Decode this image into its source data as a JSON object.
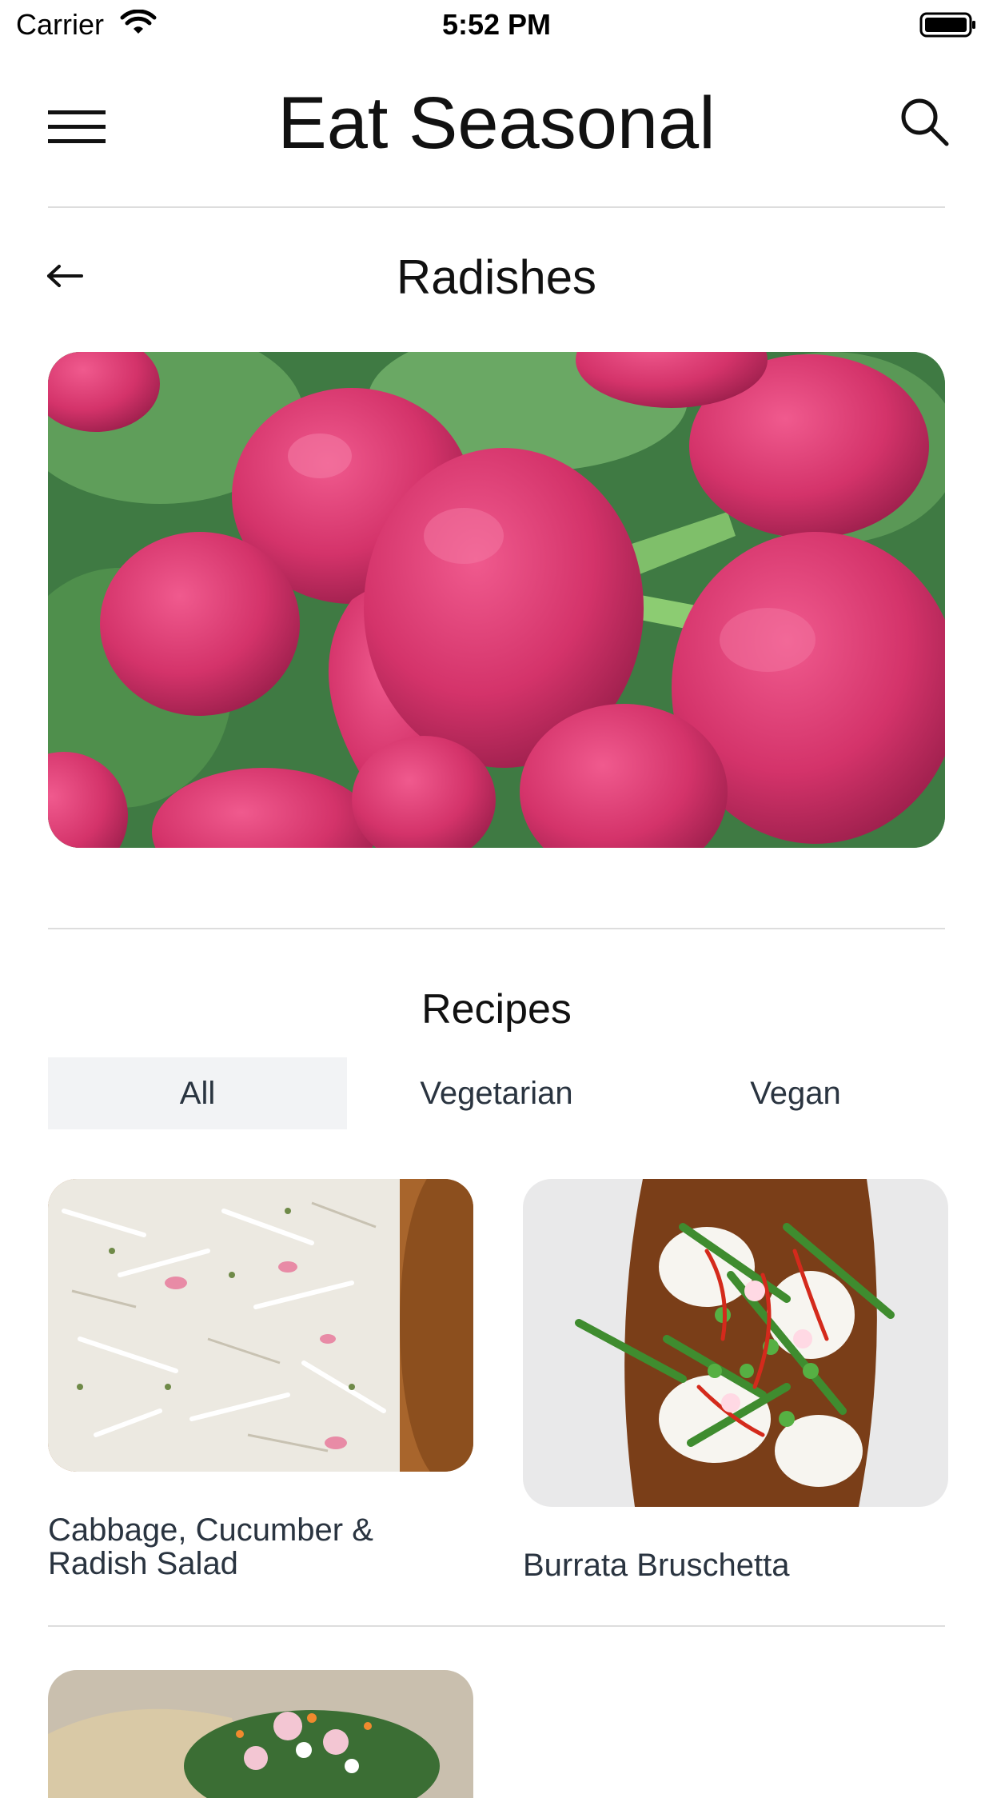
{
  "status_bar": {
    "carrier": "Carrier",
    "time": "5:52 PM"
  },
  "app_bar": {
    "title": "Eat Seasonal"
  },
  "detail": {
    "title": "Radishes"
  },
  "recipes": {
    "section_title": "Recipes",
    "filters": [
      {
        "label": "All",
        "active": true
      },
      {
        "label": "Vegetarian",
        "active": false
      },
      {
        "label": "Vegan",
        "active": false
      }
    ],
    "items": [
      {
        "title": "Cabbage, Cucumber & Radish Salad"
      },
      {
        "title": "Burrata Bruschetta"
      }
    ]
  },
  "icons": [
    "wifi-icon",
    "battery-icon",
    "menu-icon",
    "search-icon",
    "back-arrow-icon"
  ],
  "colors": {
    "radish": "#d4336a",
    "leaf": "#4c8a4a",
    "text": "#2a3440",
    "active_tab_bg": "#f2f3f5"
  }
}
